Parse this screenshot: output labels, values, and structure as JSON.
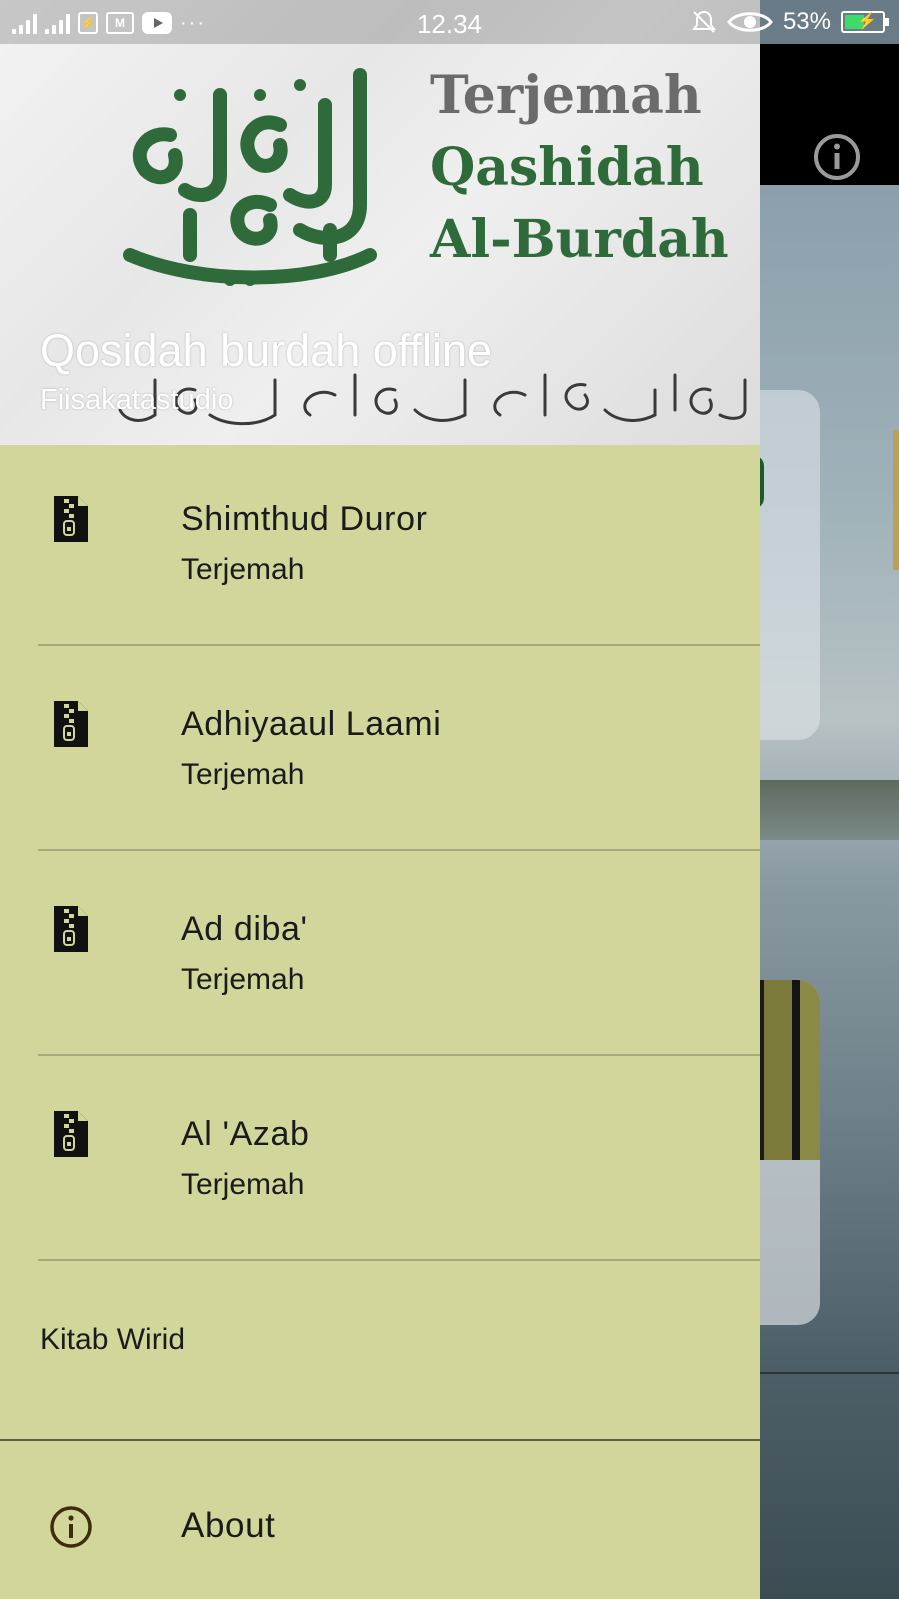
{
  "status_bar": {
    "time": "12.34",
    "battery_percent": "53%",
    "battery_level": 0.53,
    "icons": [
      "signal-icon",
      "signal-icon",
      "battery-saver-icon",
      "gmail-icon",
      "youtube-icon",
      "more-dots-icon",
      "notifications-muted-icon",
      "eye-comfort-icon",
      "battery-charging-icon"
    ]
  },
  "drawer": {
    "header": {
      "banner_title_lines": [
        "Terjemah",
        "Qashidah",
        "Al-Burdah"
      ],
      "title": "Qosidah burdah offline",
      "subtitle": "Fiisakatastudio"
    },
    "items": [
      {
        "title": "Shimthud Duror",
        "subtitle": "Terjemah",
        "icon": "zip-file-icon"
      },
      {
        "title": "Adhiyaaul Laami",
        "subtitle": "Terjemah",
        "icon": "zip-file-icon"
      },
      {
        "title": "Ad diba'",
        "subtitle": "Terjemah",
        "icon": "zip-file-icon"
      },
      {
        "title": "Al 'Azab",
        "subtitle": "Terjemah",
        "icon": "zip-file-icon"
      }
    ],
    "section_label": "Kitab Wirid",
    "about": {
      "label": "About",
      "icon": "info-icon"
    }
  },
  "background_app": {
    "toolbar_icon": "info-icon"
  },
  "colors": {
    "drawer_bg": "#d2d69a",
    "divider": "#a7aa78",
    "text": "#1b1b1b",
    "banner_green": "#2f6b3a",
    "about_icon": "#3d2e0a"
  }
}
